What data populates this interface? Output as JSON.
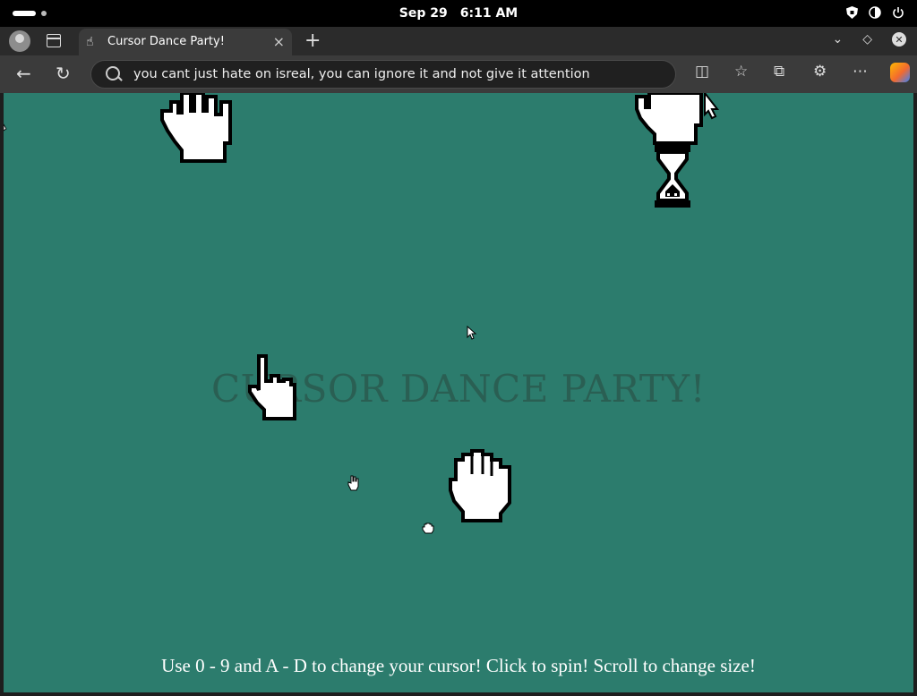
{
  "os": {
    "date": "Sep 29",
    "time": "6:11 AM",
    "tray_icons": [
      "shield-icon",
      "volume-icon",
      "power-icon"
    ]
  },
  "browser": {
    "tab": {
      "title": "Cursor Dance Party!",
      "favicon": "hand-cursor-icon"
    },
    "new_tab_symbol": "+",
    "close_symbol": "×",
    "address": "you cant just hate on isreal, you can ignore it and not give it attention",
    "toolbar_icons": [
      "back-icon",
      "reload-icon",
      "split-screen-icon",
      "favorites-icon",
      "collections-icon",
      "extensions-icon",
      "more-icon",
      "copilot-icon"
    ]
  },
  "page": {
    "title": "CURSOR DANCE PARTY!",
    "instructions": "Use 0 - 9 and A - D to change your cursor! Click to spin! Scroll to change size!",
    "background_color": "#2c7c6d",
    "title_color": "#2a5f53",
    "cursors": [
      "open-hand-cursor",
      "open-hand-cursor",
      "hourglass-cursor",
      "pointing-hand-cursor",
      "grab-hand-cursor",
      "arrow-cursor",
      "small-hand-cursor",
      "small-grab-cursor"
    ]
  }
}
